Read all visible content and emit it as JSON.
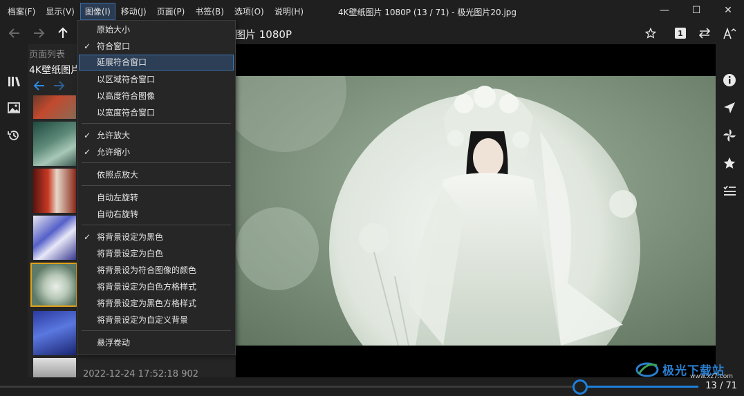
{
  "window": {
    "title": "4K壁纸图片 1080P (13 / 71) - 极光图片20.jpg",
    "minimize": "—",
    "maximize": "☐",
    "close": "✕"
  },
  "menubar": [
    {
      "label": "档案(F)"
    },
    {
      "label": "显示(V)"
    },
    {
      "label": "图像(I)",
      "active": true
    },
    {
      "label": "移动(J)"
    },
    {
      "label": "页面(P)"
    },
    {
      "label": "书签(B)"
    },
    {
      "label": "选项(O)"
    },
    {
      "label": "说明(H)"
    }
  ],
  "toolbar": {
    "address_title": "图片 1080P",
    "page_badge": "1"
  },
  "panel": {
    "header": "页面列表",
    "subtitle": "4K壁纸图片",
    "footer": "2022-12-24 17:52:18   902"
  },
  "image_menu": {
    "items": [
      {
        "label": "原始大小",
        "checked": false
      },
      {
        "label": "符合窗口",
        "checked": true
      },
      {
        "label": "延展符合窗口",
        "checked": false,
        "highlighted": true
      },
      {
        "label": "以区域符合窗口",
        "checked": false
      },
      {
        "label": "以高度符合图像",
        "checked": false
      },
      {
        "label": "以宽度符合窗口",
        "checked": false
      },
      {
        "label": "允许放大",
        "checked": true
      },
      {
        "label": "允许缩小",
        "checked": true
      },
      {
        "label": "依照点放大",
        "checked": false
      },
      {
        "label": "自动左旋转",
        "checked": false
      },
      {
        "label": "自动右旋转",
        "checked": false
      },
      {
        "label": "将背景设定为黑色",
        "checked": true
      },
      {
        "label": "将背景设定为白色",
        "checked": false
      },
      {
        "label": "将背景设为符合图像的颜色",
        "checked": false
      },
      {
        "label": "将背景设定为白色方格样式",
        "checked": false
      },
      {
        "label": "将背景设定为黑色方格样式",
        "checked": false
      },
      {
        "label": "将背景设定为自定义背景",
        "checked": false
      },
      {
        "label": "悬浮卷动",
        "checked": false
      }
    ],
    "check_glyph": "✓"
  },
  "status": {
    "page_count": "13 / 71",
    "position": 0.169
  },
  "watermark": {
    "text": "极光下载站",
    "url": "www.xz7.com"
  },
  "colors": {
    "accent": "#1e7fd8",
    "selection": "#e3a21a"
  }
}
